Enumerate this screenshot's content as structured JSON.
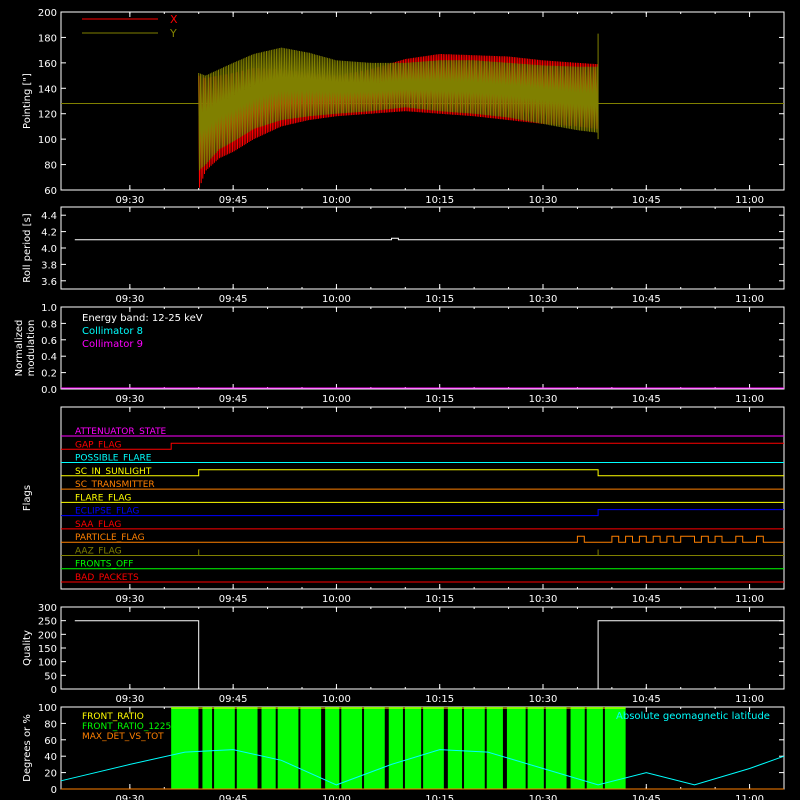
{
  "colors": {
    "background": "#000000",
    "axis": "#ffffff",
    "x_red": "#ff0000",
    "y_olive": "#808000",
    "cyan": "#00ffff",
    "magenta": "#ff00ff",
    "green": "#00ff00",
    "orange": "#ff8000",
    "yellow": "#ffff00",
    "blue": "#0000ff",
    "white": "#ffffff"
  },
  "time_ticks": [
    "09:30",
    "09:45",
    "10:00",
    "10:15",
    "10:30",
    "10:45",
    "11:00"
  ],
  "chart_data": [
    {
      "id": "pointing",
      "type": "line",
      "ylabel": "Pointing [\"]",
      "ylim": [
        60,
        200
      ],
      "yticks": [
        "60",
        "80",
        "100",
        "120",
        "140",
        "160",
        "180",
        "200"
      ],
      "legend": [
        "X",
        "Y"
      ],
      "x_range": [
        "09:20",
        "11:05"
      ],
      "series": [
        {
          "name": "X",
          "color": "#ff0000",
          "x": [
            "09:40",
            "09:41",
            "09:43",
            "09:45",
            "09:48",
            "09:52",
            "09:56",
            "10:00",
            "10:05",
            "10:10",
            "10:15",
            "10:20",
            "10:25",
            "10:30",
            "10:35",
            "10:38"
          ],
          "upper": [
            150,
            148,
            150,
            152,
            156,
            155,
            152,
            150,
            155,
            163,
            167,
            166,
            165,
            162,
            160,
            159
          ],
          "lower": [
            60,
            75,
            85,
            90,
            100,
            110,
            115,
            118,
            120,
            122,
            120,
            118,
            115,
            112,
            110,
            108
          ]
        },
        {
          "name": "Y",
          "color": "#808000",
          "x": [
            "09:40",
            "09:41",
            "09:43",
            "09:45",
            "09:48",
            "09:52",
            "09:56",
            "10:00",
            "10:05",
            "10:10",
            "10:15",
            "10:20",
            "10:25",
            "10:30",
            "10:35",
            "10:38"
          ],
          "upper": [
            152,
            150,
            155,
            160,
            167,
            172,
            168,
            162,
            160,
            160,
            162,
            162,
            160,
            158,
            157,
            157
          ],
          "lower": [
            75,
            80,
            92,
            98,
            108,
            115,
            118,
            120,
            122,
            125,
            122,
            120,
            117,
            112,
            107,
            105
          ]
        }
      ],
      "constant_line": {
        "value": 128,
        "color": "#808000"
      },
      "spike": {
        "x": "10:38",
        "from": 100,
        "to": 183
      }
    },
    {
      "id": "roll_period",
      "type": "line",
      "ylabel": "Roll period [s]",
      "ylim": [
        3.5,
        4.5
      ],
      "yticks": [
        "3.6",
        "3.8",
        "4.0",
        "4.2",
        "4.4"
      ],
      "series": [
        {
          "name": "",
          "color": "#ffffff",
          "x": [
            "09:22",
            "10:08",
            "10:08",
            "10:09",
            "10:09",
            "10:43",
            "11:05"
          ],
          "values": [
            4.1,
            4.1,
            4.12,
            4.12,
            4.1,
            4.1,
            4.1
          ]
        }
      ]
    },
    {
      "id": "modulation",
      "type": "line",
      "ylabel": "Normalized modulation",
      "ylim": [
        0,
        1
      ],
      "yticks": [
        "0.0",
        "0.2",
        "0.4",
        "0.6",
        "0.8",
        "1.0"
      ],
      "annotation": "Energy band: 12-25 keV",
      "legend": [
        "Collimator 8",
        "Collimator 9"
      ],
      "series": [
        {
          "name": "Collimator 8",
          "color": "#00ffff",
          "values": [
            0,
            0
          ]
        },
        {
          "name": "Collimator 9",
          "color": "#ff00ff",
          "values": [
            0,
            0
          ]
        }
      ]
    },
    {
      "id": "flags",
      "type": "line",
      "ylabel": "Flags",
      "flags": [
        {
          "name": "ATTENUATOR_STATE",
          "color": "#ff00ff",
          "transitions": []
        },
        {
          "name": "GAP_FLAG",
          "color": "#ff0000",
          "transitions": [
            [
              "09:36",
              1
            ],
            [
              "10:42",
              1
            ]
          ]
        },
        {
          "name": "POSSIBLE_FLARE",
          "color": "#00ffff",
          "transitions": []
        },
        {
          "name": "SC_IN_SUNLIGHT",
          "color": "#ffff00",
          "transitions": [
            [
              "09:40",
              1
            ],
            [
              "10:38",
              0
            ]
          ]
        },
        {
          "name": "SC_TRANSMITTER",
          "color": "#ff8000",
          "transitions": []
        },
        {
          "name": "FLARE_FLAG",
          "color": "#ffff00",
          "transitions": []
        },
        {
          "name": "ECLIPSE_FLAG",
          "color": "#0000ff",
          "transitions": [
            [
              "09:40",
              0
            ],
            [
              "10:38",
              1
            ]
          ]
        },
        {
          "name": "SAA_FLAG",
          "color": "#ff0000",
          "transitions": []
        },
        {
          "name": "PARTICLE_FLAG",
          "color": "#ff8000",
          "transitions": [
            [
              "10:35",
              1
            ],
            [
              "10:36",
              0
            ],
            [
              "10:40",
              1
            ],
            [
              "10:41",
              0
            ],
            [
              "10:42",
              1
            ],
            [
              "10:43",
              0
            ],
            [
              "10:44",
              1
            ],
            [
              "10:45",
              0
            ],
            [
              "10:46",
              1
            ],
            [
              "10:47",
              0
            ],
            [
              "10:48",
              1
            ],
            [
              "10:49",
              0
            ],
            [
              "10:50",
              1
            ],
            [
              "10:52",
              0
            ],
            [
              "10:53",
              1
            ],
            [
              "10:54",
              0
            ],
            [
              "10:55",
              1
            ],
            [
              "10:56",
              0
            ],
            [
              "10:58",
              1
            ],
            [
              "10:59",
              0
            ],
            [
              "11:01",
              1
            ],
            [
              "11:02",
              0
            ]
          ]
        },
        {
          "name": "AAZ_FLAG",
          "color": "#808000",
          "transitions": [
            [
              "09:40",
              1
            ],
            [
              "09:40",
              0
            ],
            [
              "10:38",
              1
            ],
            [
              "10:38",
              0
            ]
          ]
        },
        {
          "name": "FRONTS_OFF",
          "color": "#00ff00",
          "transitions": []
        },
        {
          "name": "BAD_PACKETS",
          "color": "#ff0000",
          "transitions": []
        }
      ]
    },
    {
      "id": "quality",
      "type": "line",
      "ylabel": "Quality",
      "ylim": [
        0,
        300
      ],
      "yticks": [
        "0",
        "50",
        "100",
        "150",
        "200",
        "250",
        "300"
      ],
      "series": [
        {
          "name": "",
          "color": "#ffffff",
          "x": [
            "09:22",
            "09:40",
            "09:40",
            "10:38",
            "10:38",
            "11:05"
          ],
          "values": [
            250,
            250,
            0,
            0,
            250,
            250
          ]
        }
      ]
    },
    {
      "id": "geomag",
      "type": "line",
      "ylabel": "Degrees or %",
      "ylim": [
        0,
        100
      ],
      "yticks": [
        "0",
        "20",
        "40",
        "60",
        "80",
        "100"
      ],
      "legend": [
        "FRONT_RATIO",
        "FRONT_RATIO_1225",
        "MAX_DET_VS_TOT"
      ],
      "annotation": "Absolute geomagnetic latitude",
      "series": [
        {
          "name": "FRONT_RATIO",
          "color": "#ffff00",
          "values": [
            0
          ]
        },
        {
          "name": "FRONT_RATIO_1225",
          "color": "#00ff00",
          "x_range": [
            "09:36",
            "10:42"
          ],
          "values": [
            0,
            100
          ]
        },
        {
          "name": "MAX_DET_VS_TOT",
          "color": "#ff8000",
          "values": [
            0
          ]
        },
        {
          "name": "Absolute geomagnetic latitude",
          "color": "#00ffff",
          "x": [
            "09:20",
            "09:30",
            "09:38",
            "09:45",
            "09:52",
            "10:00",
            "10:08",
            "10:15",
            "10:22",
            "10:30",
            "10:38",
            "10:45",
            "10:52",
            "11:00",
            "11:05"
          ],
          "values": [
            10,
            30,
            45,
            48,
            35,
            5,
            30,
            48,
            45,
            25,
            5,
            20,
            5,
            25,
            40
          ]
        }
      ]
    }
  ]
}
